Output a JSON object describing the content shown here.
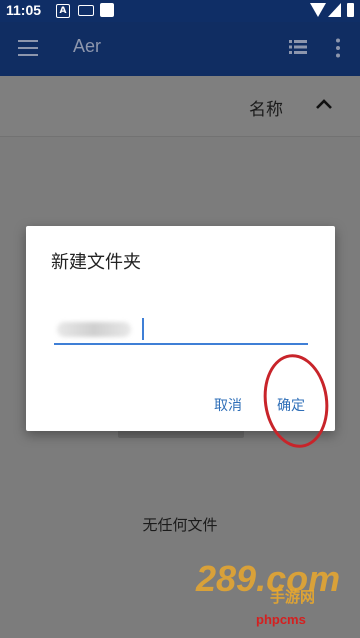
{
  "status_bar": {
    "time": "11:05",
    "icons": [
      "notification-a-icon",
      "keyboard-icon",
      "square-icon",
      "wifi-icon",
      "signal-icon",
      "battery-icon"
    ]
  },
  "app_bar": {
    "title": "Aer",
    "icons": [
      "menu-icon",
      "list-view-icon",
      "more-vert-icon"
    ]
  },
  "sort_bar": {
    "label": "名称",
    "direction_icon": "chevron-up-icon"
  },
  "dialog": {
    "title": "新建文件夹",
    "input_value": "",
    "cancel_label": "取消",
    "ok_label": "确定"
  },
  "empty_state": {
    "text": "无任何文件"
  },
  "watermark": {
    "logo_text": "289.com",
    "logo_sub": "手游网",
    "small_text": "phpcms"
  },
  "colors": {
    "app_bar_bg": "#102d62",
    "accent": "#3f7fd6",
    "annotation": "#c8242a"
  }
}
